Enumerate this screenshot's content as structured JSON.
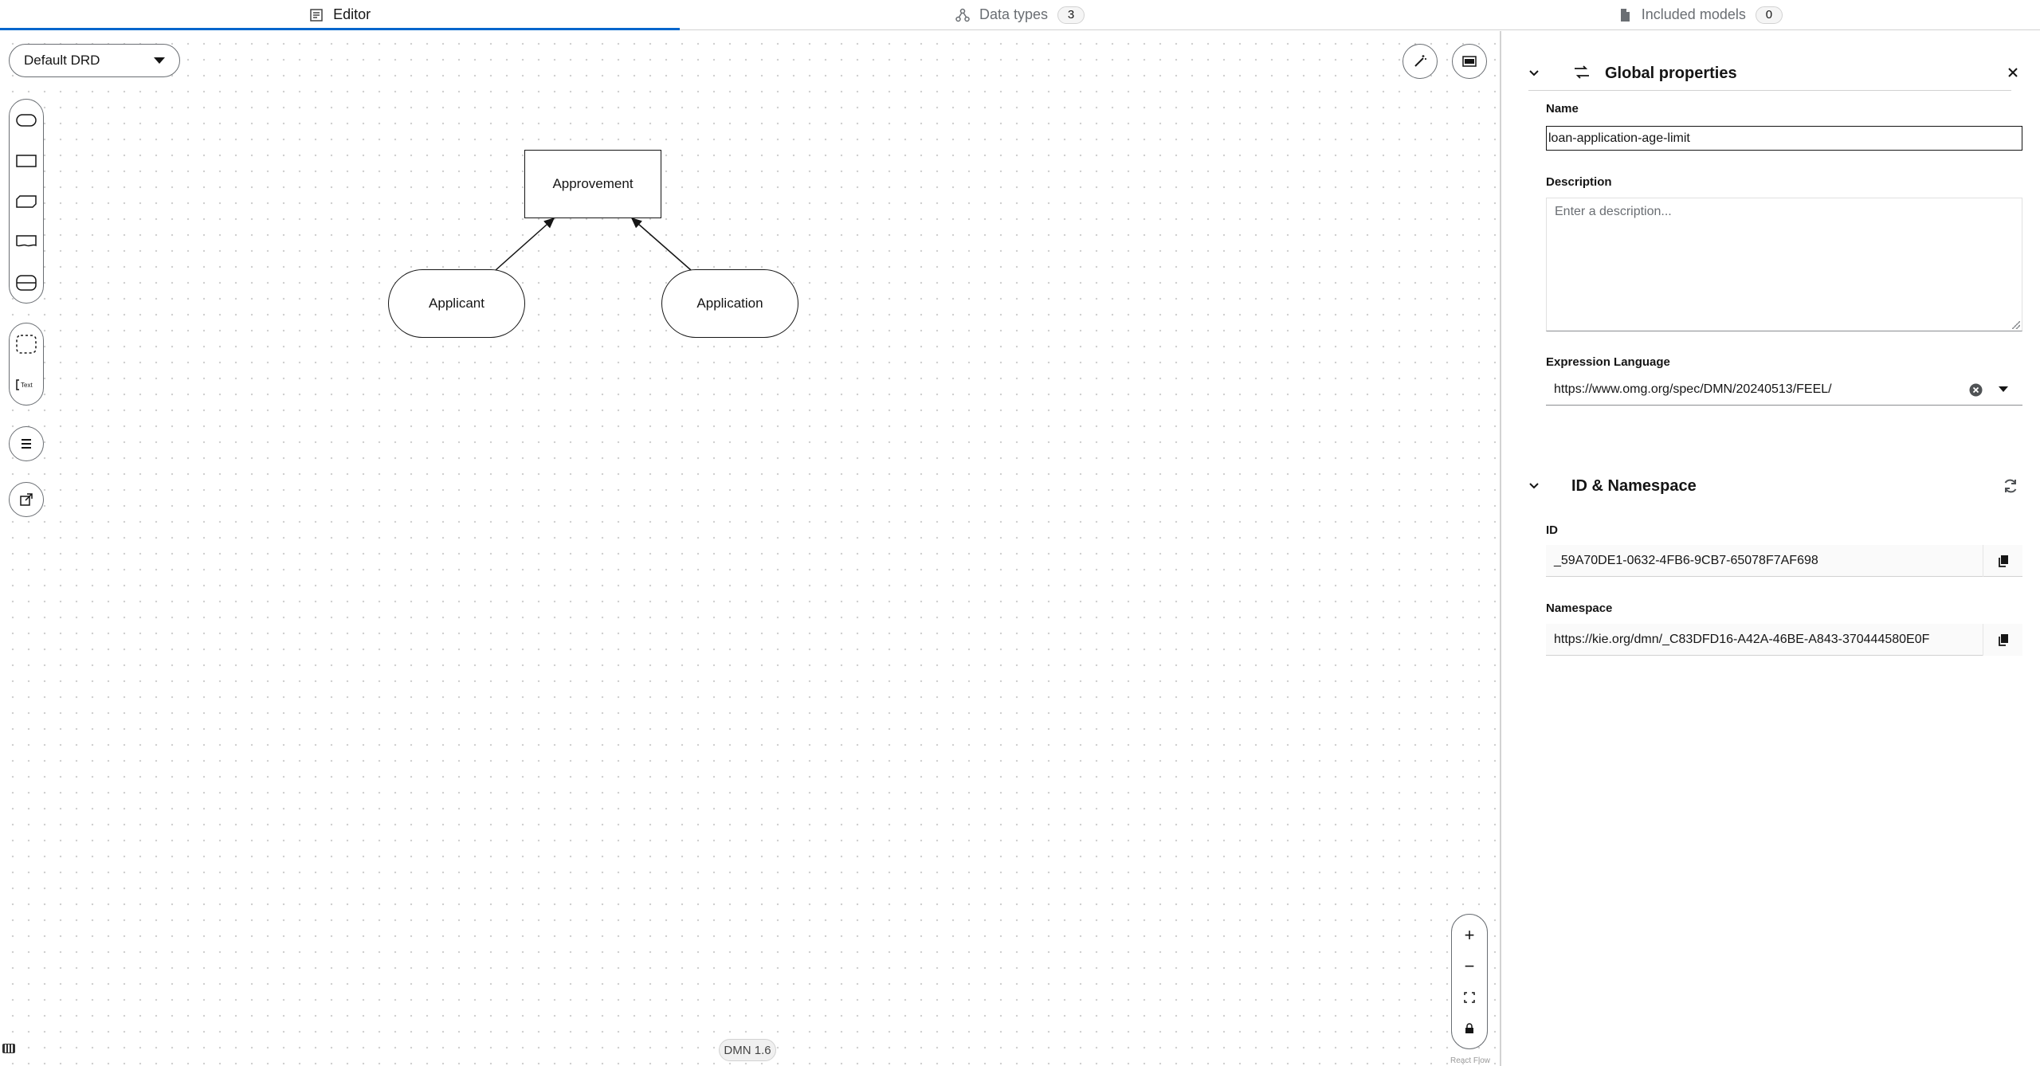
{
  "tabs": [
    {
      "label": "Editor",
      "icon": "editor-icon",
      "active": true
    },
    {
      "label": "Data types",
      "icon": "data-types-icon",
      "count": "3"
    },
    {
      "label": "Included models",
      "icon": "included-models-icon",
      "count": "0"
    }
  ],
  "canvas": {
    "drd_selector": "Default DRD",
    "nodes": {
      "decision": "Approvement",
      "input_left": "Applicant",
      "input_right": "Application"
    },
    "dmn_version": "DMN 1.6",
    "react_flow": "React Flow",
    "zoom": {
      "in": "+",
      "out": "−"
    }
  },
  "panel": {
    "global": {
      "title": "Global properties",
      "name_label": "Name",
      "name_value": "loan-application-age-limit",
      "description_label": "Description",
      "description_placeholder": "Enter a description...",
      "expression_language_label": "Expression Language",
      "expression_language_value": "https://www.omg.org/spec/DMN/20240513/FEEL/"
    },
    "id_ns": {
      "title": "ID & Namespace",
      "id_label": "ID",
      "id_value": "_59A70DE1-0632-4FB6-9CB7-65078F7AF698",
      "namespace_label": "Namespace",
      "namespace_value": "https://kie.org/dmn/_C83DFD16-A42A-46BE-A843-370444580E0F"
    }
  },
  "colors": {
    "accent": "#0066cc",
    "border": "#6a6e73",
    "text": "#151515"
  }
}
